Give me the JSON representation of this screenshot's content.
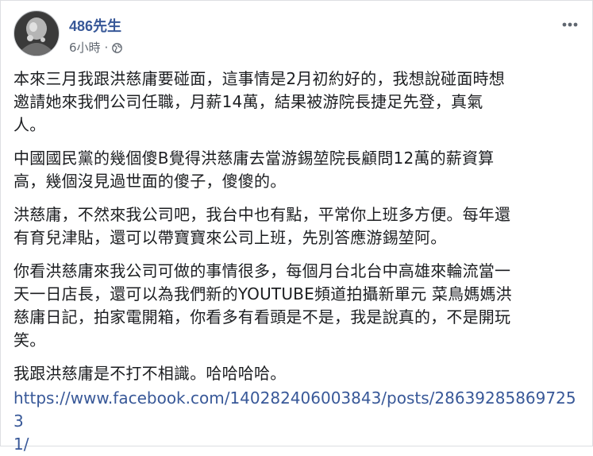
{
  "post": {
    "author": "486先生",
    "timestamp": "6小時",
    "separator": "·",
    "privacy_icon": "globe-icon",
    "more_icon": "more-options-icon",
    "paragraphs": [
      "本來三月我跟洪慈庸要碰面，這事情是2月初約好的，我想說碰面時想\n邀請她來我們公司任職，月薪14萬，結果被游院長捷足先登，真氣\n人。",
      "中國國民黨的幾個傻B覺得洪慈庸去當游錫堃院長顧問12萬的薪資算\n高，幾個沒見過世面的傻子，傻傻的。",
      "洪慈庸，不然來我公司吧，我台中也有點，平常你上班多方便。每年還\n有育兒津貼，還可以帶寶寶來公司上班，先別答應游錫堃阿。",
      "你看洪慈庸來我公司可做的事情很多，每個月台北台中高雄來輪流當一\n天一日店長，還可以為我們新的YOUTUBE頻道拍攝新單元 菜鳥媽媽洪\n慈庸日記，拍家電開箱，你看多有看頭是不是，我是說真的，不是開玩\n笑。",
      "我跟洪慈庸是不打不相識。哈哈哈哈。"
    ],
    "link": "https://www.facebook.com/140282406003843/posts/286392858697253\n1/"
  },
  "colors": {
    "link": "#385898",
    "meta": "#606770",
    "text": "#1c1e21"
  }
}
